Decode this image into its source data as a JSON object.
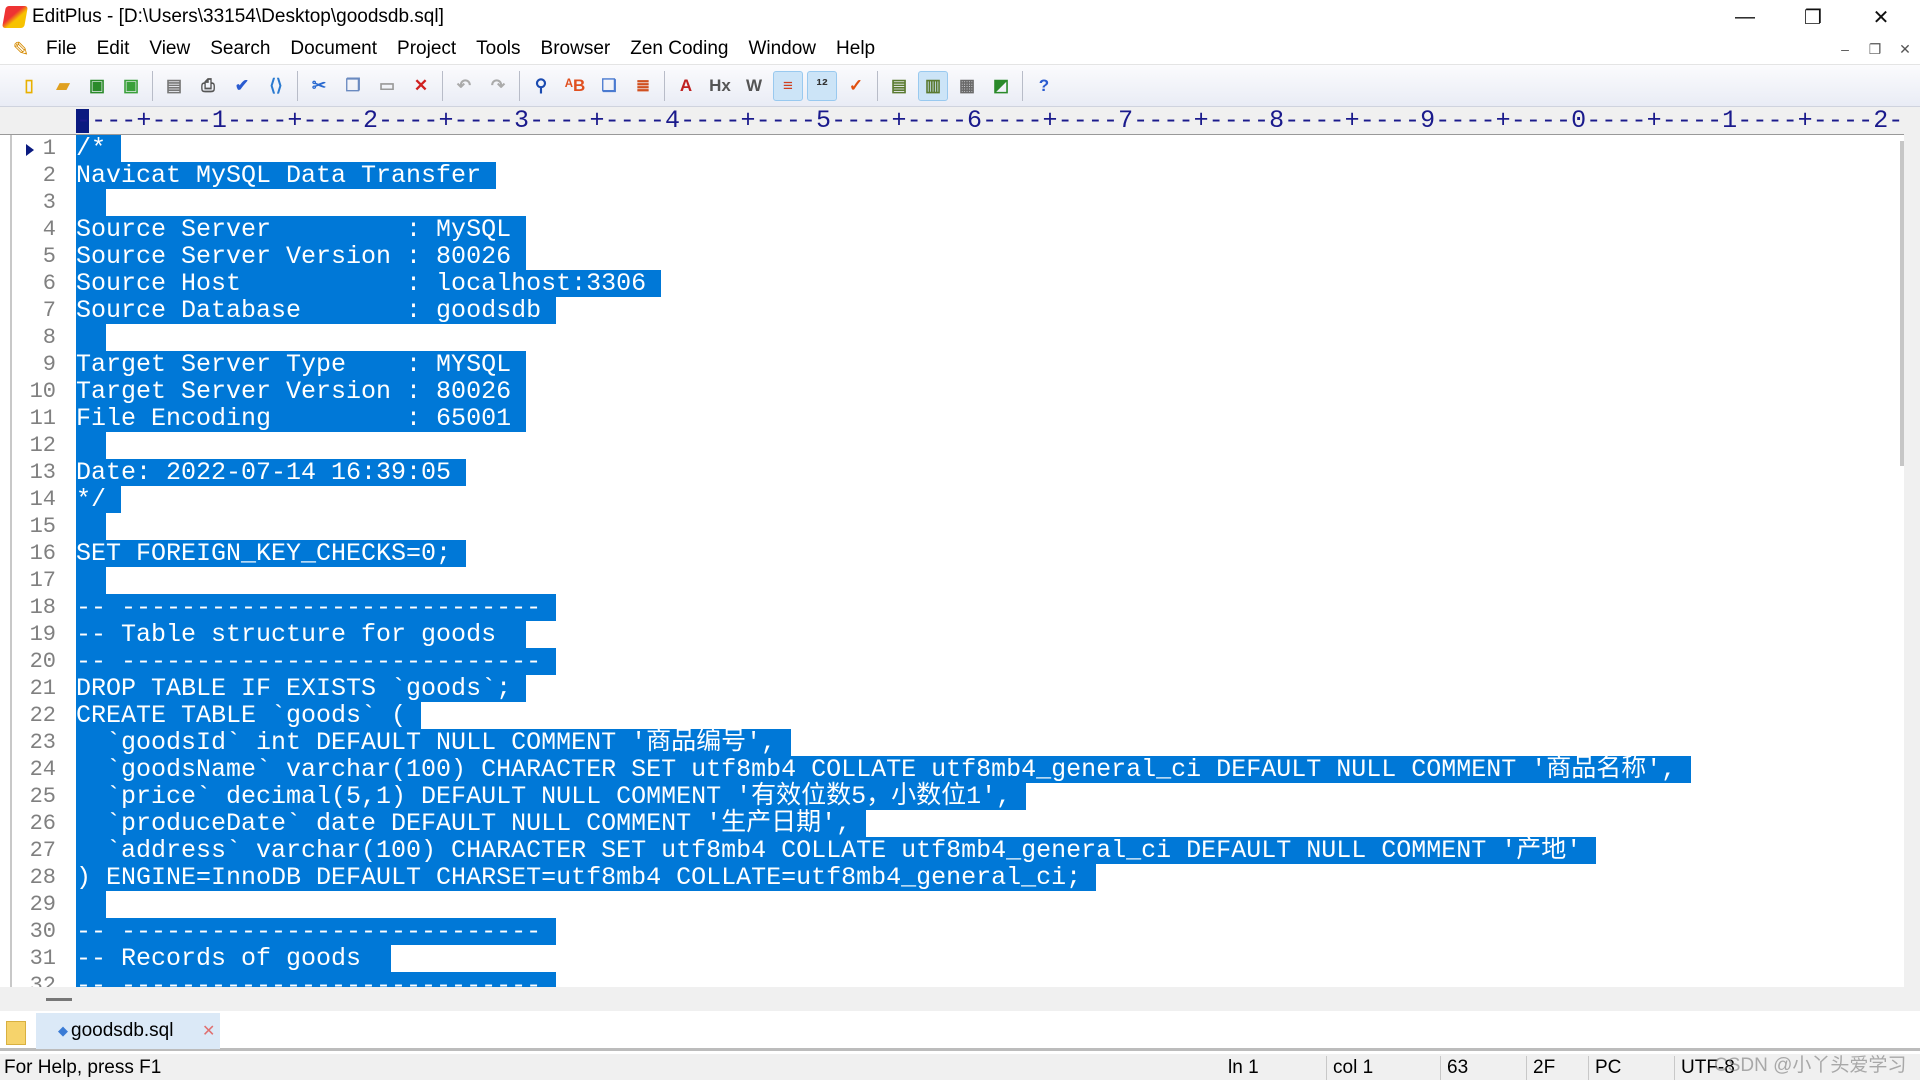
{
  "window": {
    "title": "EditPlus - [D:\\Users\\33154\\Desktop\\goodsdb.sql]",
    "controls": [
      "minimize",
      "restore",
      "close"
    ]
  },
  "menu": [
    "File",
    "Edit",
    "View",
    "Search",
    "Document",
    "Project",
    "Tools",
    "Browser",
    "Zen Coding",
    "Window",
    "Help"
  ],
  "toolbar": [
    {
      "icon": "new-file-icon",
      "g": "▯",
      "c": "#e8b000"
    },
    {
      "icon": "open-icon",
      "g": "▰",
      "c": "#e0a020"
    },
    {
      "icon": "save-icon",
      "g": "▣",
      "c": "#2a8a2a"
    },
    {
      "icon": "save-all-icon",
      "g": "▣",
      "c": "#3aa03a"
    },
    "|",
    {
      "icon": "print-preview-icon",
      "g": "▤",
      "c": "#777"
    },
    {
      "icon": "print-icon",
      "g": "⎙",
      "c": "#555"
    },
    {
      "icon": "spell-check-icon",
      "g": "✔",
      "c": "#2a5bd0"
    },
    {
      "icon": "browser-preview-icon",
      "g": "⟨⟩",
      "c": "#2a7ad0"
    },
    "|",
    {
      "icon": "cut-icon",
      "g": "✂",
      "c": "#2a6ad0"
    },
    {
      "icon": "copy-icon",
      "g": "❐",
      "c": "#6a8ac0"
    },
    {
      "icon": "paste-icon",
      "g": "▭",
      "c": "#999"
    },
    {
      "icon": "delete-icon",
      "g": "✕",
      "c": "#d02020"
    },
    "|",
    {
      "icon": "undo-icon",
      "g": "↶",
      "c": "#aaa"
    },
    {
      "icon": "redo-icon",
      "g": "↷",
      "c": "#aaa"
    },
    "|",
    {
      "icon": "find-icon",
      "g": "⚲",
      "c": "#1a4ab0"
    },
    {
      "icon": "replace-icon",
      "g": "ᴬB",
      "c": "#e05020"
    },
    {
      "icon": "find-in-files-icon",
      "g": "❏",
      "c": "#4a7ad0"
    },
    {
      "icon": "line-numbers-icon",
      "g": "≣",
      "c": "#d05020"
    },
    "|",
    {
      "icon": "font-icon",
      "g": "A",
      "c": "#c02020"
    },
    {
      "icon": "hex-icon",
      "g": "Hx",
      "c": "#555"
    },
    {
      "icon": "word-wrap-icon",
      "g": "W",
      "c": "#555"
    },
    {
      "icon": "ruler-icon",
      "g": "≡",
      "c": "#d04020",
      "on": true
    },
    {
      "icon": "line-number-toggle-icon",
      "g": "¹²",
      "c": "#333",
      "on": true
    },
    {
      "icon": "check-icon",
      "g": "✓",
      "c": "#e05010"
    },
    "|",
    {
      "icon": "directory-window-icon",
      "g": "▤",
      "c": "#5a7a30"
    },
    {
      "icon": "cliptext-window-icon",
      "g": "▥",
      "c": "#5a7a30",
      "on": true
    },
    {
      "icon": "output-window-icon",
      "g": "▦",
      "c": "#6a6a6a"
    },
    {
      "icon": "fullscreen-icon",
      "g": "◩",
      "c": "#2a8a2a"
    },
    "|",
    {
      "icon": "help-icon",
      "g": "?",
      "c": "#2a5bd0"
    }
  ],
  "ruler": "----+----1----+----2----+----3----+----4----+----5----+----6----+----7----+----8----+----9----+----0----+----1----+----2-",
  "editor": {
    "selection_color": "#0078d7",
    "lines": [
      "/*",
      "Navicat MySQL Data Transfer",
      "",
      "Source Server         : MySQL",
      "Source Server Version : 80026",
      "Source Host           : localhost:3306",
      "Source Database       : goodsdb",
      "",
      "Target Server Type    : MYSQL",
      "Target Server Version : 80026",
      "File Encoding         : 65001",
      "",
      "Date: 2022-07-14 16:39:05",
      "*/",
      "",
      "SET FOREIGN_KEY_CHECKS=0;",
      "",
      "-- ----------------------------",
      "-- Table structure for goods ",
      "-- ----------------------------",
      "DROP TABLE IF EXISTS `goods`;",
      "CREATE TABLE `goods` (",
      "  `goodsId` int DEFAULT NULL COMMENT '商品编号',",
      "  `goodsName` varchar(100) CHARACTER SET utf8mb4 COLLATE utf8mb4_general_ci DEFAULT NULL COMMENT '商品名称',",
      "  `price` decimal(5,1) DEFAULT NULL COMMENT '有效位数5，小数位1',",
      "  `produceDate` date DEFAULT NULL COMMENT '生产日期',",
      "  `address` varchar(100) CHARACTER SET utf8mb4 COLLATE utf8mb4_general_ci DEFAULT NULL COMMENT '产地'",
      ") ENGINE=InnoDB DEFAULT CHARSET=utf8mb4 COLLATE=utf8mb4_general_ci;",
      "",
      "-- ----------------------------",
      "-- Records of goods ",
      "-- ----------------------------"
    ]
  },
  "tabs": [
    {
      "label": "goodsdb.sql",
      "active": true
    }
  ],
  "status": {
    "help": "For Help, press F1",
    "ln": "ln 1",
    "col": "col 1",
    "chars": "63",
    "hex": "2F",
    "eol": "PC",
    "encoding": "UTF-8"
  },
  "watermark": "CSDN @小丫头爱学习"
}
